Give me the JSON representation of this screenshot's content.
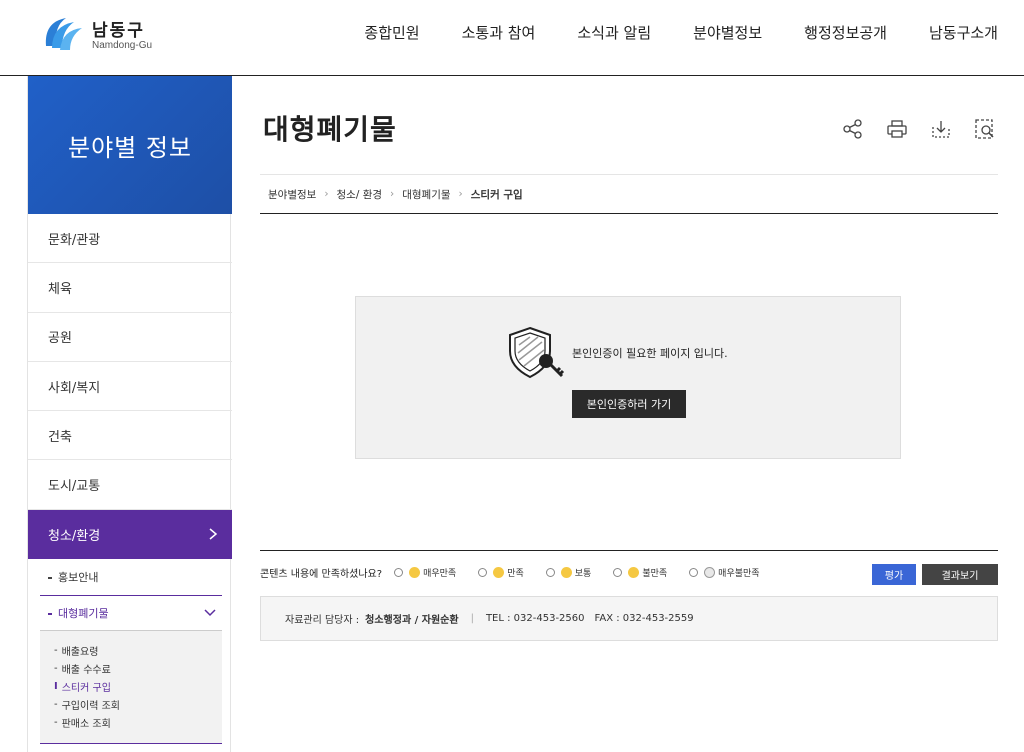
{
  "header": {
    "logo_title": "남동구",
    "logo_sub": "Namdong-Gu",
    "logo_badge": "남동구",
    "nav": [
      "종합민원",
      "소통과 참여",
      "소식과 알림",
      "분야별정보",
      "행정정보공개",
      "남동구소개"
    ]
  },
  "sidebar": {
    "title": "분야별 정보",
    "items": [
      "문화/관광",
      "체육",
      "공원",
      "사회/복지",
      "건축",
      "도시/교통"
    ],
    "active": "청소/환경",
    "sub": [
      "홍보안내",
      "대형폐기물"
    ],
    "third": [
      "배출요령",
      "배출 수수료",
      "스티커 구입",
      "구입이력 조회",
      "판매소 조회"
    ]
  },
  "main": {
    "title": "대형폐기물",
    "breadcrumb": [
      "분야별정보",
      "청소/ 환경",
      "대형폐기물",
      "스티커 구입"
    ],
    "auth_msg": "본인인증이 필요한 페이지 입니다.",
    "auth_btn": "본인인증하러 가기"
  },
  "survey": {
    "question": "콘텐츠 내용에 만족하셨나요?",
    "options": [
      "매우만족",
      "만족",
      "보통",
      "불만족",
      "매우불만족"
    ],
    "eval_btn": "평가",
    "result_btn": "결과보기"
  },
  "manager": {
    "label": "자료관리 담당자 :",
    "dept": "청소행정과 / 자원순환",
    "tel": "TEL :  032-453-2560",
    "fax": "FAX :  032-453-2559"
  },
  "colors": {
    "brand_blue": "#1e4fa6",
    "active_purple": "#5a2d9e",
    "eval_blue": "#3a66d6"
  }
}
